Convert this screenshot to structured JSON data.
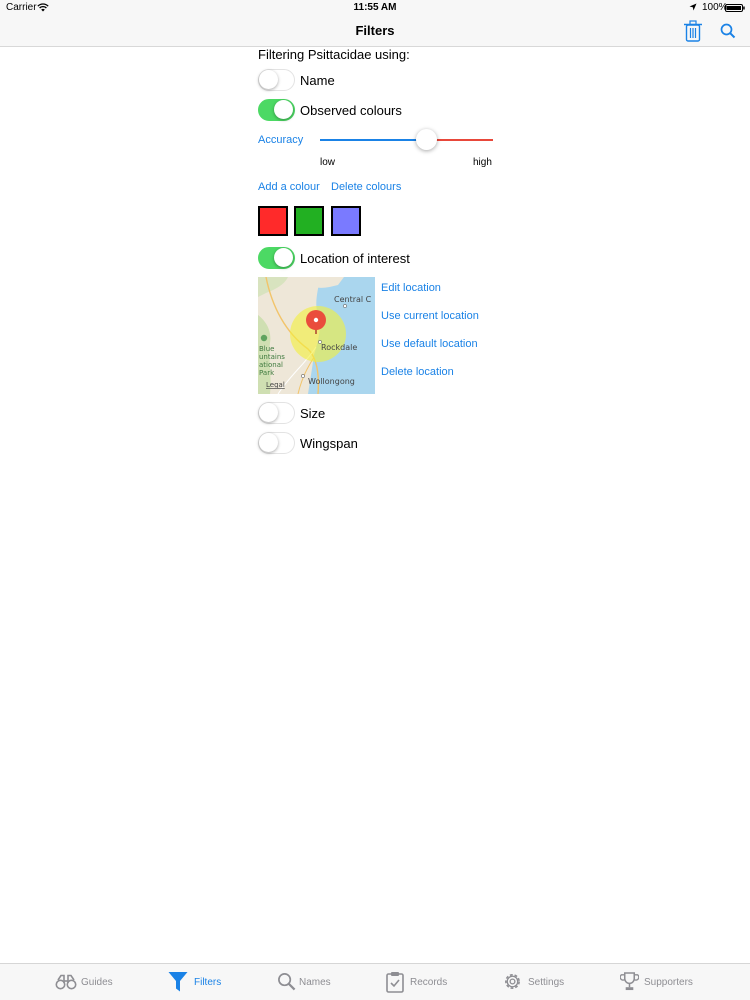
{
  "status_bar": {
    "carrier": "Carrier",
    "time": "11:55 AM",
    "battery": "100%"
  },
  "nav": {
    "title": "Filters",
    "icons": {
      "trash": "trash-icon",
      "search": "search-icon"
    }
  },
  "filter": {
    "heading": "Filtering Psittacidae using:",
    "toggles": [
      {
        "label": "Name",
        "on": false
      },
      {
        "label": "Observed colours",
        "on": true
      },
      {
        "label": "Location of interest",
        "on": true
      },
      {
        "label": "Size",
        "on": false
      },
      {
        "label": "Wingspan",
        "on": false
      }
    ],
    "accuracy": {
      "label": "Accuracy",
      "low": "low",
      "high": "high",
      "value": 0.61
    },
    "colour_links": {
      "add": "Add a colour",
      "delete": "Delete colours"
    },
    "colours": [
      "#ff2a2a",
      "#22b022",
      "#7a7aff"
    ],
    "location_links": {
      "edit": "Edit location",
      "current": "Use current location",
      "default": "Use default location",
      "delete": "Delete location"
    },
    "map_labels": {
      "central": "Central C",
      "rockdale": "Rockdale",
      "wollongong": "Wollongong",
      "park": [
        "Blue",
        "untains",
        "ational",
        "Park"
      ],
      "legal": "Legal"
    }
  },
  "tab_bar": {
    "active": "Filters",
    "accent": "#1a82e6",
    "items": [
      {
        "label": "Guides",
        "icon": "binoculars-icon"
      },
      {
        "label": "Filters",
        "icon": "funnel-icon"
      },
      {
        "label": "Names",
        "icon": "magnifier-icon"
      },
      {
        "label": "Records",
        "icon": "clipboard-icon"
      },
      {
        "label": "Settings",
        "icon": "gear-icon"
      },
      {
        "label": "Supporters",
        "icon": "trophy-icon"
      }
    ]
  }
}
